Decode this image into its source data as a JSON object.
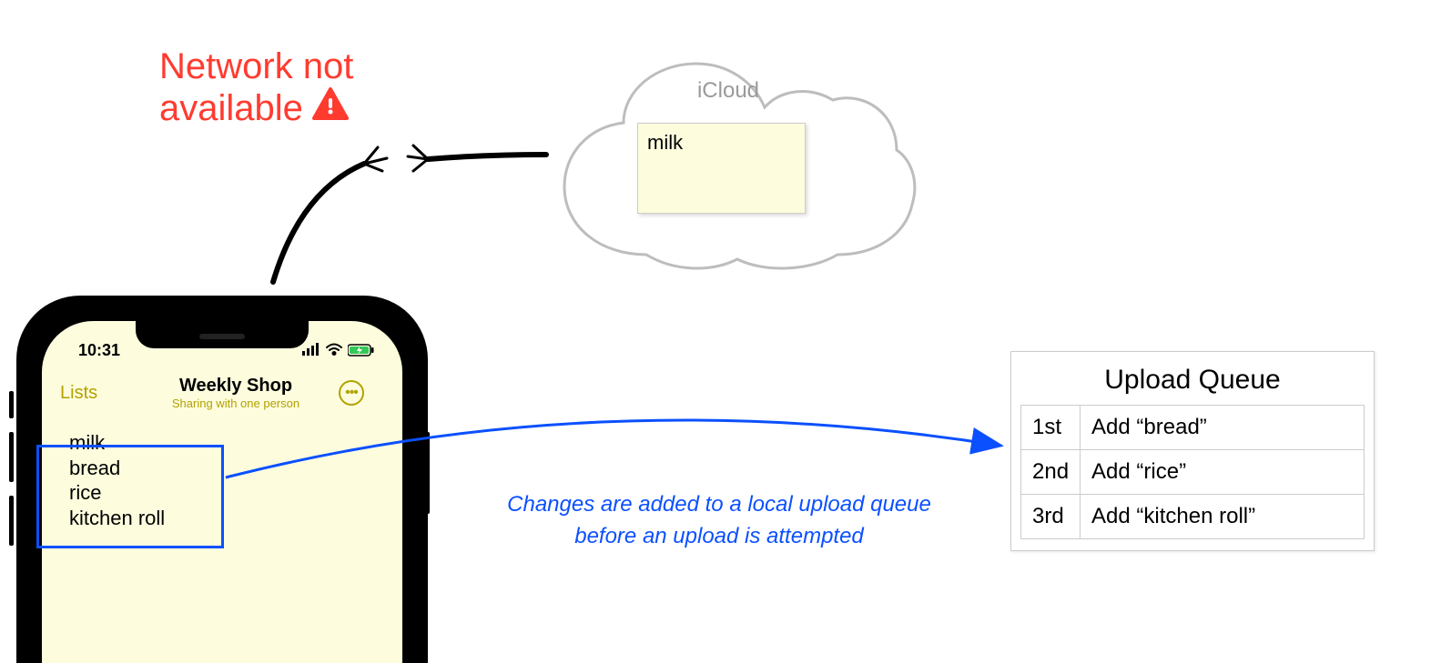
{
  "warning": {
    "line1": "Network not",
    "line2": "available"
  },
  "cloud": {
    "label": "iCloud",
    "note_item": "milk"
  },
  "phone": {
    "status": {
      "time": "10:31"
    },
    "nav": {
      "back": "Lists",
      "title": "Weekly Shop",
      "subtitle": "Sharing with one person"
    },
    "items": [
      "milk",
      "bread",
      "rice",
      "kitchen roll"
    ]
  },
  "caption": "Changes are added to a local upload queue before an upload is attempted",
  "queue": {
    "title": "Upload Queue",
    "rows": [
      {
        "ord": "1st",
        "action": "Add “bread”"
      },
      {
        "ord": "2nd",
        "action": "Add “rice”"
      },
      {
        "ord": "3rd",
        "action": "Add “kitchen roll”"
      }
    ]
  }
}
